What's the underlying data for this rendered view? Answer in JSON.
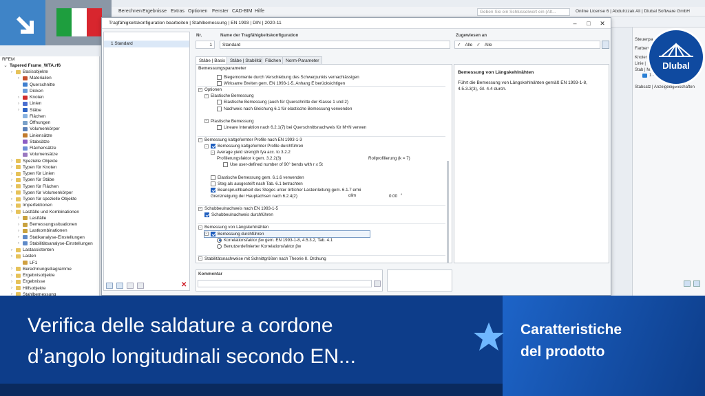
{
  "app": {
    "menu": [
      "Berechnen",
      "Ergebnisse",
      "Extras",
      "Optionen",
      "Fenster",
      "CAD-BIM",
      "Hilfe"
    ],
    "search_placeholder": "Geben Sie ein Schlüsselwort ein (Alt...",
    "license": "Online License 6 | Abdulrzzak Ali | Dlubal Software GmbH"
  },
  "navigator": {
    "root": "RFEM",
    "file": "Tapered Frame_WTA.rf6",
    "items": [
      "Basisobjekte",
      "Materialien",
      "Querschnitte",
      "Dicken",
      "Knoten",
      "Linien",
      "Stäbe",
      "Flächen",
      "Öffnungen",
      "Volumenkörper",
      "Liniensätze",
      "Stabsätze",
      "Flächensätze",
      "Volumensätze",
      "Spezielle Objekte",
      "Typen für Knoten",
      "Typen für Linien",
      "Typen für Stäbe",
      "Typen für Flächen",
      "Typen für Volumenkörper",
      "Typen für spezielle Objekte",
      "Imperfektionen",
      "Lastfälle und Kombinationen",
      "Lastfälle",
      "Bemessungssituationen",
      "Lastkombinationen",
      "Statikanalyse-Einstellungen",
      "Stabilitätsanalyse-Einstellungen",
      "Lastassistenten",
      "Lasten",
      "LF1",
      "Berechnungsdiagramme",
      "Ergebnisobjekte",
      "Ergebnisse",
      "Hilfsobjekte",
      "Stahlbemessung"
    ]
  },
  "dialog": {
    "title": "Tragfähigkeitskonfiguration bearbeiten | Stahlbemessung | EN 1993 | DIN | 2020-11",
    "list_item": "1  Standard",
    "no_label": "Nr.",
    "no_value": "1",
    "name_label": "Name der Tragfähigkeitskonfiguration",
    "name_value": "Standard",
    "assigned_label": "Zugewiesen an",
    "assigned_1": "Alle",
    "assigned_2": "Alle",
    "tabs": [
      "Stäbe | Basis",
      "Stäbe | Stabilität",
      "Flächen",
      "Norm-Parameter"
    ],
    "params_header": "Bemessungsparameter",
    "rows": [
      {
        "t": "Biegemomente durch Verschiebung des Schwerpunkts vernachlässigen",
        "lvl": 3,
        "kind": "cb",
        "on": false
      },
      {
        "t": "Wirksame Breiten gem. EN 1993-1-5, Anhang E berücksichtigen",
        "lvl": 3,
        "kind": "cb",
        "on": false
      },
      {
        "t": "Optionen",
        "lvl": 0,
        "kind": "grp"
      },
      {
        "t": "Elastische Bemessung",
        "lvl": 1,
        "kind": "grp"
      },
      {
        "t": "Elastische Bemessung (auch für Querschnitte der Klasse 1 und 2)",
        "lvl": 3,
        "kind": "cb",
        "on": false
      },
      {
        "t": "Nachweis nach Gleichung 6.1 für elastische Bemessung verwenden",
        "lvl": 3,
        "kind": "cb",
        "on": false
      },
      {
        "t": "",
        "lvl": 0,
        "kind": "blank"
      },
      {
        "t": "Plastische Bemessung",
        "lvl": 1,
        "kind": "grp"
      },
      {
        "t": "Lineare Interaktion nach 6.2.1(7) bei Querschnittsnachweis für M+N verwen",
        "lvl": 3,
        "kind": "cb",
        "on": false
      },
      {
        "t": "",
        "lvl": 0,
        "kind": "blank"
      },
      {
        "t": "Bemessung kaltgeformter Profile nach EN 1993-1-3",
        "lvl": 0,
        "kind": "grp"
      },
      {
        "t": "Bemessung kaltgeformter Profile durchführen",
        "lvl": 1,
        "kind": "cbg",
        "on": true
      },
      {
        "t": "Average yield strength fya acc. to 3.2.2",
        "lvl": 2,
        "kind": "grp"
      },
      {
        "t": "Profilierungsfaktor k gem. 3.2.2(3)",
        "lvl": 3,
        "kind": "txt",
        "v": "Rollprofilierung (k = 7)"
      },
      {
        "t": "Use user-defined number of 90° bends with r ≤ 5t",
        "lvl": 4,
        "kind": "cb",
        "on": false
      },
      {
        "t": "",
        "lvl": 0,
        "kind": "blank"
      },
      {
        "t": "Elastische Bemessung gem. 6.1.6 verwenden",
        "lvl": 2,
        "kind": "cb",
        "on": false
      },
      {
        "t": "Steg als ausgesteift nach Tab. 6.1 betrachten",
        "lvl": 2,
        "kind": "cb",
        "on": false
      },
      {
        "t": "Beanspruchbarkeit des Steges unter örtlicher Lasteinleitung gem. 6.1.7 ermi",
        "lvl": 2,
        "kind": "cb",
        "on": true
      },
      {
        "t": "Grenzneigung der Hauptachsen nach 6.2.4(2)",
        "lvl": 2,
        "kind": "txt",
        "v": "0.00",
        "sym": "αlim",
        "unit": "°"
      },
      {
        "t": "",
        "lvl": 0,
        "kind": "blank"
      },
      {
        "t": "Schubbeulnachweis nach EN 1993-1-5",
        "lvl": 0,
        "kind": "grp"
      },
      {
        "t": "Schubbeulnachweis durchführen",
        "lvl": 1,
        "kind": "cb",
        "on": true
      },
      {
        "t": "",
        "lvl": 0,
        "kind": "blank"
      },
      {
        "t": "Bemessung von Längskehlnähten",
        "lvl": 0,
        "kind": "grp"
      },
      {
        "t": "Bemessung durchführen",
        "lvl": 1,
        "kind": "cbg",
        "on": true,
        "sel": true
      },
      {
        "t": "Korrelationsfaktor βw gem. EN 1993-1-8, 4.5.3.2, Tab. 4.1",
        "lvl": 3,
        "kind": "rb",
        "on": true
      },
      {
        "t": "Benutzerdefinierter Korrelationsfaktor βw",
        "lvl": 3,
        "kind": "rb",
        "on": false
      },
      {
        "t": "",
        "lvl": 0,
        "kind": "blank"
      },
      {
        "t": "Stabilitätsnachweise mit Schnittgrößen nach Theorie II. Ordnung",
        "lvl": 0,
        "kind": "grp"
      },
      {
        "t": "γM1 zur Ermittlung der Querschnittsbeanspruchbarkeit verwenden",
        "lvl": 1,
        "kind": "cb",
        "on": false
      }
    ],
    "info_title": "Bemessung von Längskehlnähten",
    "info_text": "Führt die Bemessung von Längskehlnähten gemäß EN 1993-1-8, 4.5.3.3(3), Gl. 4.4 durch.",
    "comment_label": "Kommentar"
  },
  "right_panel": {
    "title": "Steuerpa",
    "line1": "Farben",
    "line2": "Knoten",
    "line3": "Linie |",
    "line4": "Stab | Ma",
    "line5": "1 - S235",
    "line6": "Stabsatz | Anzeigeeigenschaften"
  },
  "banner": {
    "title_line1": "Verifica delle saldature a cordone",
    "title_line2": "d’angolo longitudinali secondo EN...",
    "category_line1": "Caratteristiche",
    "category_line2": "del prodotto",
    "brand": "Dlubal"
  },
  "colors": {
    "banner": "#0d3d8a",
    "accent": "#3f84c7",
    "check": "#1f5fbf"
  }
}
